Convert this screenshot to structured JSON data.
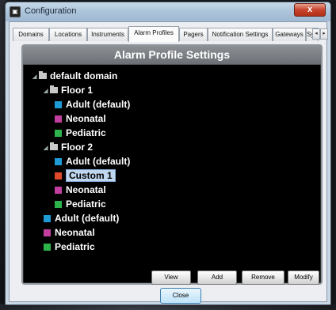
{
  "window": {
    "title": "Configuration",
    "app_icon": "app-icon-glyph",
    "close_glyph": "x"
  },
  "tabs": [
    {
      "label": "Domains"
    },
    {
      "label": "Locations"
    },
    {
      "label": "Instruments"
    },
    {
      "label": "Alarm Profiles"
    },
    {
      "label": "Pagers"
    },
    {
      "label": "Notification Settings"
    },
    {
      "label": "Gateways"
    },
    {
      "label": "Syst"
    }
  ],
  "tab_scroll": {
    "left_glyph": "◂",
    "right_glyph": "▸"
  },
  "active_tab": "Alarm Profiles",
  "panel": {
    "title": "Alarm Profile Settings"
  },
  "tree": [
    {
      "label": "default domain",
      "type": "domain"
    },
    {
      "label": "Floor 1",
      "type": "floor"
    },
    {
      "label": "Adult (default)",
      "type": "profile",
      "color": "#1e9bd7"
    },
    {
      "label": "Neonatal",
      "type": "profile",
      "color": "#c23fa0"
    },
    {
      "label": "Pediatric",
      "type": "profile",
      "color": "#2db34a"
    },
    {
      "label": "Floor 2",
      "type": "floor"
    },
    {
      "label": "Adult (default)",
      "type": "profile",
      "color": "#1e9bd7"
    },
    {
      "label": "Custom 1",
      "type": "profile",
      "color": "#e04a2a",
      "selected": true
    },
    {
      "label": "Neonatal",
      "type": "profile",
      "color": "#c23fa0"
    },
    {
      "label": "Pediatric",
      "type": "profile",
      "color": "#2db34a"
    },
    {
      "label": "Adult (default)",
      "type": "profile",
      "color": "#1e9bd7"
    },
    {
      "label": "Neonatal",
      "type": "profile",
      "color": "#c23fa0"
    },
    {
      "label": "Pediatric",
      "type": "profile",
      "color": "#2db34a"
    }
  ],
  "actions": {
    "view": "View",
    "add": "Add",
    "remove": "Remove",
    "modify": "Modify"
  },
  "footer": {
    "close": "Close"
  },
  "colors": {
    "adult": "#1e9bd7",
    "neonatal": "#c23fa0",
    "pediatric": "#2db34a",
    "custom": "#e04a2a",
    "selection": "#c0d6ef"
  }
}
